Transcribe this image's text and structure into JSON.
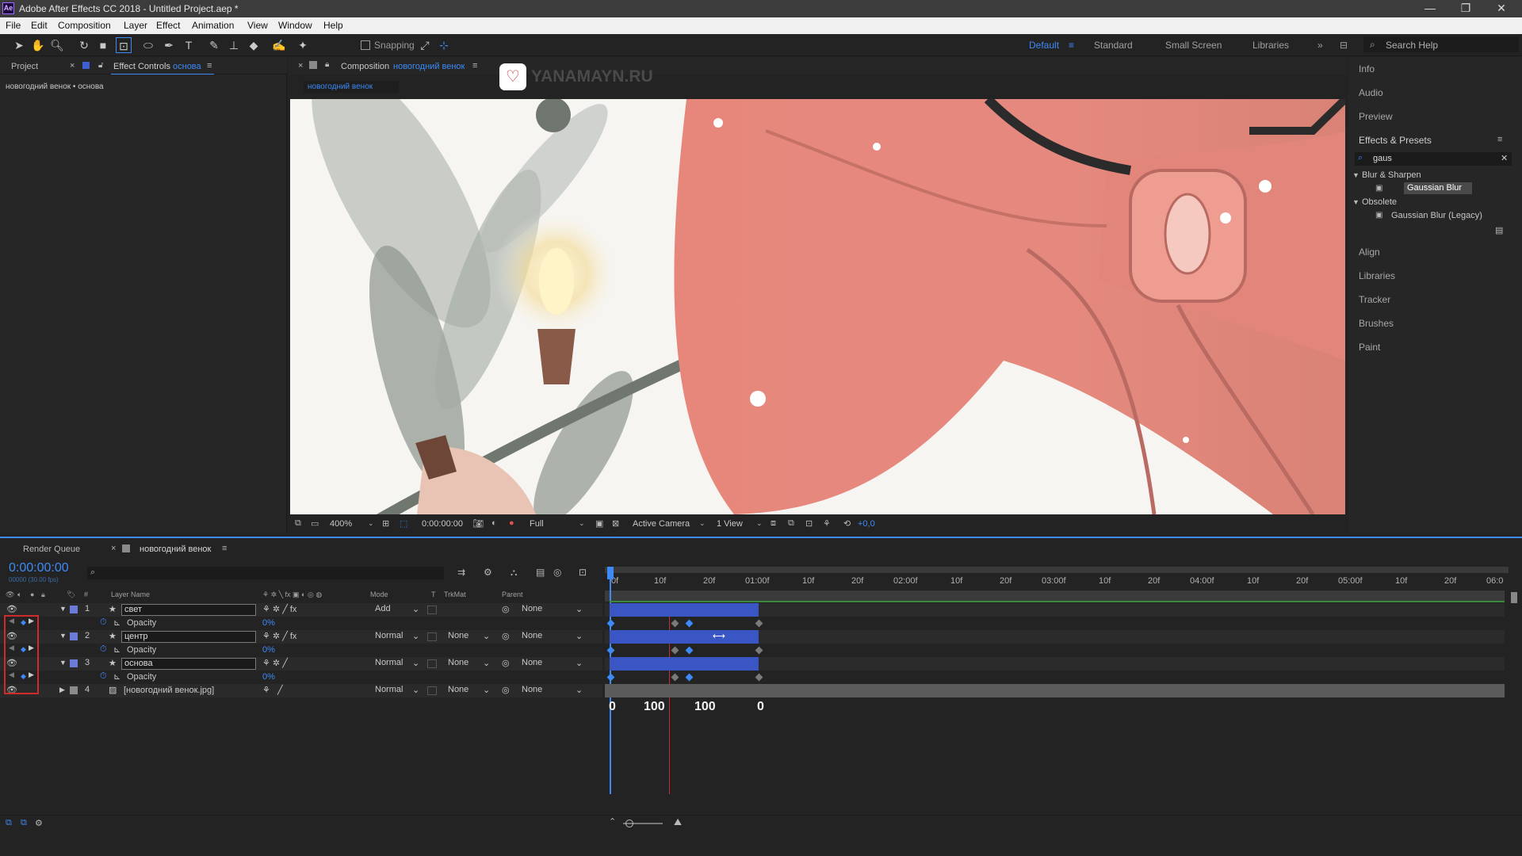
{
  "window": {
    "title": "Adobe After Effects CC 2018 - Untitled Project.aep *",
    "app_icon": "Ae"
  },
  "menu": [
    "File",
    "Edit",
    "Composition",
    "Layer",
    "Effect",
    "Animation",
    "View",
    "Window",
    "Help"
  ],
  "toolbar": {
    "snapping": "Snapping",
    "workspaces": [
      "Default",
      "Standard",
      "Small Screen",
      "Libraries"
    ],
    "search_help": "Search Help"
  },
  "left": {
    "tab_project": "Project",
    "tab_effect_controls": "Effect Controls",
    "effect_controls_layer": "основа",
    "breadcrumb": "новогодний венок • основа"
  },
  "comp": {
    "tab_label": "Composition",
    "comp_name": "новогодний венок",
    "subtab": "новогодний венок",
    "watermark": "YANAMAYN.RU",
    "zoom": "400%",
    "timecode": "0:00:00:00",
    "resolution": "Full",
    "camera": "Active Camera",
    "views": "1 View",
    "exposure": "+0,0"
  },
  "right": {
    "info": "Info",
    "audio": "Audio",
    "preview": "Preview",
    "effects_presets": "Effects & Presets",
    "search_value": "gaus",
    "cat1": "Blur & Sharpen",
    "item1": "Gaussian Blur",
    "cat2": "Obsolete",
    "item2": "Gaussian Blur (Legacy)",
    "align": "Align",
    "libraries": "Libraries",
    "tracker": "Tracker",
    "brushes": "Brushes",
    "paint": "Paint"
  },
  "timeline": {
    "tab_render": "Render Queue",
    "tab_comp": "новогодний венок",
    "timecode": "0:00:00:00",
    "fps": "00000 (30.00 fps)",
    "headers": {
      "hash": "#",
      "layer_name": "Layer Name",
      "mode": "Mode",
      "t": "T",
      "trkmat": "TrkMat",
      "parent": "Parent"
    },
    "ruler": [
      "0f",
      "10f",
      "20f",
      "01:00f",
      "10f",
      "20f",
      "02:00f",
      "10f",
      "20f",
      "03:00f",
      "10f",
      "20f",
      "04:00f",
      "10f",
      "20f",
      "05:00f",
      "10f",
      "20f",
      "06:0"
    ],
    "layers": [
      {
        "num": "1",
        "name": "свет",
        "mode": "Add",
        "trkmat": "",
        "parent": "None",
        "prop": "Opacity",
        "prop_val": "0%"
      },
      {
        "num": "2",
        "name": "центр",
        "mode": "Normal",
        "trkmat": "None",
        "parent": "None",
        "prop": "Opacity",
        "prop_val": "0%"
      },
      {
        "num": "3",
        "name": "основа",
        "mode": "Normal",
        "trkmat": "None",
        "parent": "None",
        "prop": "Opacity",
        "prop_val": "0%"
      },
      {
        "num": "4",
        "name": "[новогодний венок.jpg]",
        "mode": "Normal",
        "trkmat": "None",
        "parent": "None"
      }
    ],
    "annotations": [
      "0",
      "100",
      "100",
      "0"
    ]
  },
  "colors": {
    "accent": "#3d8af7",
    "bar": "#3a56c5",
    "label": "#6c7bd8",
    "playhead": "#d02a2a"
  }
}
